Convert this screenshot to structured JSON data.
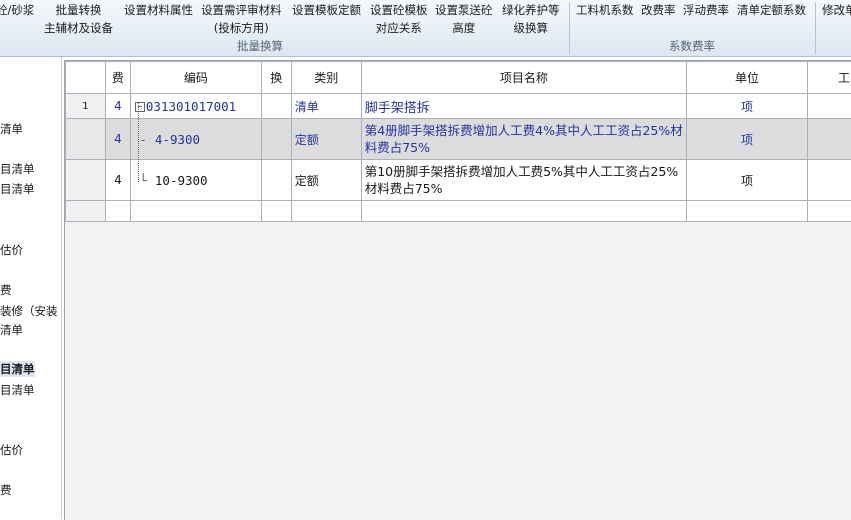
{
  "ribbon": {
    "buttons": [
      {
        "id": "b1",
        "line1": "砼/砂浆",
        "line2": ""
      },
      {
        "id": "b2",
        "line1": "批量转换",
        "line2": "主辅材及设备"
      },
      {
        "id": "b3",
        "line1": "设置材料属性",
        "line2": ""
      },
      {
        "id": "b4",
        "line1": "设置需评审材料",
        "line2": "(投标方用)"
      },
      {
        "id": "b5",
        "line1": "设置模板定额",
        "line2": ""
      },
      {
        "id": "b6",
        "line1": "设置砼模板",
        "line2": "对应关系"
      },
      {
        "id": "b7",
        "line1": "设置泵送砼",
        "line2": "高度"
      },
      {
        "id": "b8",
        "line1": "绿化养护等",
        "line2": "级换算"
      },
      {
        "id": "b9",
        "line1": "工料机系数",
        "line2": ""
      },
      {
        "id": "b10",
        "line1": "改费率",
        "line2": ""
      },
      {
        "id": "b11",
        "line1": "浮动费率",
        "line2": ""
      },
      {
        "id": "b12",
        "line1": "清单定额系数",
        "line2": ""
      },
      {
        "id": "b13",
        "line1": "修改单",
        "line2": ""
      }
    ],
    "groups": [
      "批量换算",
      "系数费率"
    ]
  },
  "leftnav": {
    "items": [
      "清单",
      "目清单",
      "目清单",
      "估价",
      "费",
      "装修（安装",
      "清单",
      "目清单",
      "目清单",
      "估价",
      "费"
    ]
  },
  "grid": {
    "headers": [
      "费",
      "编码",
      "换",
      "类别",
      "项目名称",
      "单位",
      "工"
    ],
    "rows": [
      {
        "num": "1",
        "fee": "4",
        "code": "031301017001",
        "swap": "",
        "type": "清单",
        "name": "脚手架搭拆",
        "unit": "项"
      },
      {
        "num": "",
        "fee": "4",
        "code": "4-9300",
        "swap": "",
        "type": "定额",
        "name": "第4册脚手架搭拆费增加人工费4%其中人工工资占25%材料费占75%",
        "unit": "项"
      },
      {
        "num": "",
        "fee": "4",
        "code": "10-9300",
        "swap": "",
        "type": "定额",
        "name": "第10册脚手架搭拆费增加人工费5%其中人工工资占25%材料费占75%",
        "unit": "项"
      }
    ],
    "tree_toggle": "⊟"
  }
}
